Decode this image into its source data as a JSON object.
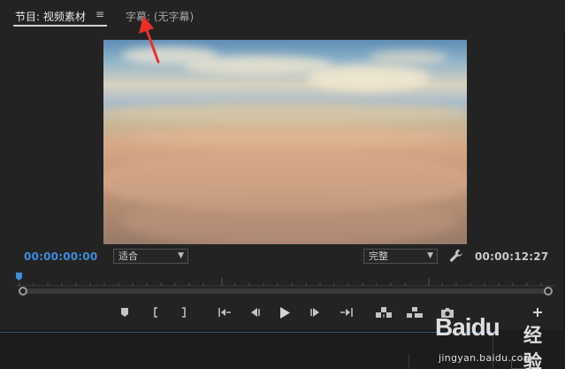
{
  "program_monitor": {
    "tabs": [
      {
        "label": "节目: 视频素材"
      },
      {
        "label": "字幕: (无字幕)"
      }
    ],
    "menu_glyph": "≡",
    "current_timecode": "00:00:00:00",
    "duration_timecode": "00:00:12:27",
    "zoom_select": {
      "selected": "适合"
    },
    "quality_select": {
      "selected": "完整"
    },
    "playhead_color": "#3b8ddb",
    "controls": [
      {
        "name": "add-marker-button",
        "icon": "marker-icon"
      },
      {
        "name": "mark-in-button",
        "icon": "mark-in-icon"
      },
      {
        "name": "mark-out-button",
        "icon": "mark-out-icon"
      },
      {
        "name": "go-to-in-button",
        "icon": "go-to-in-icon"
      },
      {
        "name": "step-back-button",
        "icon": "step-back-icon"
      },
      {
        "name": "play-button",
        "icon": "play-icon"
      },
      {
        "name": "step-forward-button",
        "icon": "step-forward-icon"
      },
      {
        "name": "go-to-out-button",
        "icon": "go-to-out-icon"
      },
      {
        "name": "lift-button",
        "icon": "lift-icon"
      },
      {
        "name": "extract-button",
        "icon": "extract-icon"
      },
      {
        "name": "export-frame-button",
        "icon": "camera-icon"
      },
      {
        "name": "button-editor-button",
        "icon": "plus-icon"
      }
    ]
  },
  "watermark": {
    "logo": "Baidu",
    "label": "经验",
    "url": "jingyan.baidu.com"
  },
  "annotation": {
    "color": "#e8312a"
  }
}
